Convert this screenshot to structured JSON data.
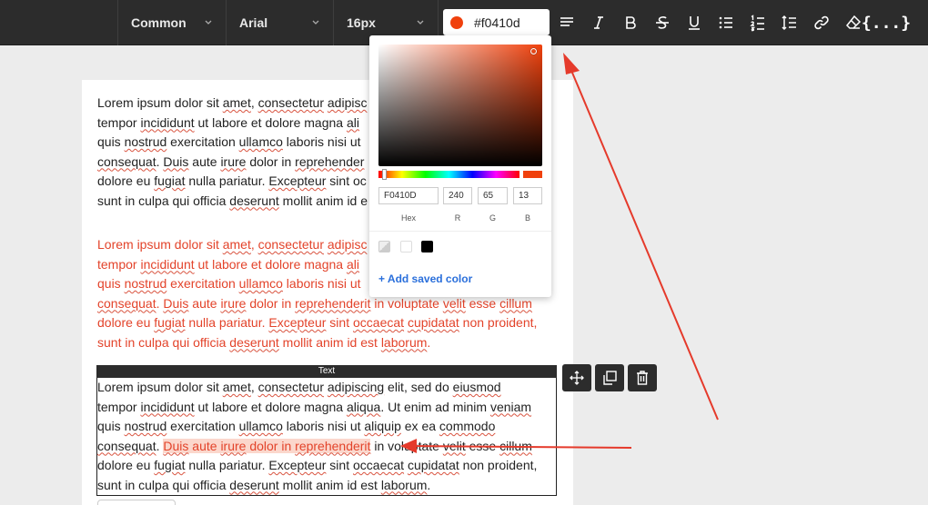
{
  "toolbar": {
    "style_select": "Common",
    "font_select": "Arial",
    "size_select": "16px",
    "color_value": "#f0410d",
    "code_label": "{...}"
  },
  "colors": {
    "accent": "#f0410d",
    "toolbar_bg": "#2c2c2c",
    "link": "#2a6fdb"
  },
  "picker": {
    "hex_value": "F0410D",
    "r_value": "240",
    "g_value": "65",
    "b_value": "13",
    "hex_label": "Hex",
    "r_label": "R",
    "g_label": "G",
    "b_label": "B",
    "add_saved_color": "+ Add saved color"
  },
  "block": {
    "tag_label": "Text"
  },
  "content": {
    "p1": {
      "l1a": "Lorem ipsum dolor sit ",
      "l1b": "amet",
      "l1c": ", ",
      "l1d": "consectetur",
      "l1e": " ",
      "l1f": "adipisc",
      "l2a": "tempor ",
      "l2b": "incididunt",
      "l2c": " ut labore et dolore magna ",
      "l2d": "ali",
      "l3a": "quis ",
      "l3b": "nostrud",
      "l3c": " exercitation ",
      "l3d": "ullamco",
      "l3e": " laboris nisi ut",
      "l4a": "consequat",
      "l4b": ". ",
      "l4c": "Duis",
      "l4d": " aute ",
      "l4e": "irure",
      "l4f": " dolor in ",
      "l4g": "reprehender",
      "l5a": "dolore eu ",
      "l5b": "fugiat",
      "l5c": " nulla pariatur. ",
      "l5d": "Excepteur",
      "l5e": " sint oc",
      "l6a": "sunt in culpa qui officia ",
      "l6b": "deserunt",
      "l6c": " mollit anim id e"
    },
    "p2": {
      "l1a": "Lorem ipsum dolor sit ",
      "l1b": "amet",
      "l1c": ", ",
      "l1d": "consectetur",
      "l1e": " ",
      "l1f": "adipisc",
      "l2a": "tempor ",
      "l2b": "incididunt",
      "l2c": " ut labore et dolore magna ",
      "l2d": "ali",
      "l3a": "quis ",
      "l3b": "nostrud",
      "l3c": " exercitation ",
      "l3d": "ullamco",
      "l3e": " laboris nisi ut",
      "l4a": "consequat",
      "l4b": ". ",
      "l4c": "Duis",
      "l4d": " aute ",
      "l4e": "irure",
      "l4f": " dolor in ",
      "l4g": "reprehenderit",
      "l4h": " in voluptate ",
      "l4i": "velit",
      "l4j": " esse ",
      "l4k": "cillum",
      "l5a": "dolore eu ",
      "l5b": "fugiat",
      "l5c": " nulla pariatur. ",
      "l5d": "Excepteur",
      "l5e": " sint ",
      "l5f": "occaecat",
      "l5g": " ",
      "l5h": "cupidatat",
      "l5i": " non proident,",
      "l6a": "sunt in culpa qui officia ",
      "l6b": "deserunt",
      "l6c": " mollit anim id est ",
      "l6d": "laborum",
      "l6e": "."
    },
    "p3": {
      "l1a": "Lorem ipsum dolor sit ",
      "l1b": "amet",
      "l1c": ", ",
      "l1d": "consectetur",
      "l1e": " ",
      "l1f": "adipiscing",
      "l1g": " elit, sed do ",
      "l1h": "eiusmod",
      "l2a": "tempor ",
      "l2b": "incididunt",
      "l2c": " ut labore et dolore magna ",
      "l2d": "aliqua",
      "l2e": ". Ut enim ad minim ",
      "l2f": "veniam",
      "l3a": "quis ",
      "l3b": "nostrud",
      "l3c": " exercitation ",
      "l3d": "ullamco",
      "l3e": " laboris nisi ut ",
      "l3f": "aliquip",
      "l3g": " ex ea ",
      "l3h": "commodo",
      "l4a": "consequat",
      "l4b": ". ",
      "l4c": "Duis",
      "l4d": " aute ",
      "l4e": "irure",
      "l4f": " dolor in ",
      "l4g": "reprehenderit",
      "l4h": " in voluptate ",
      "l4i": "velit",
      "l4j": " esse ",
      "l4k": "cillum",
      "l5a": "dolore eu ",
      "l5b": "fugiat",
      "l5c": " nulla pariatur. ",
      "l5d": "Excepteur",
      "l5e": " sint ",
      "l5f": "occaecat",
      "l5g": " ",
      "l5h": "cupidatat",
      "l5i": " non proident,",
      "l6a": "sunt in culpa qui officia ",
      "l6b": "deserunt",
      "l6c": " mollit anim id est ",
      "l6d": "laborum",
      "l6e": "."
    }
  }
}
